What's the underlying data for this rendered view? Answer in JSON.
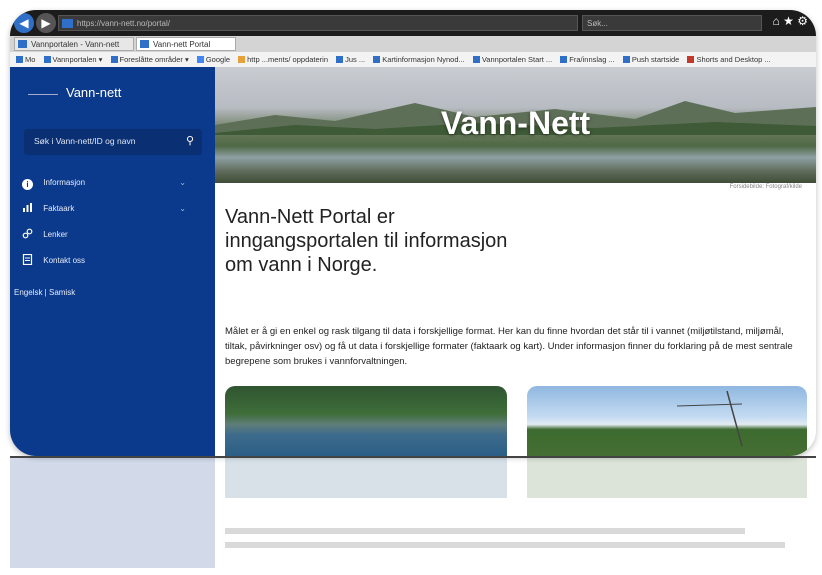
{
  "browser": {
    "url": "https://vann-nett.no/portal/",
    "search_placeholder": "Søk...",
    "tabs": [
      {
        "label": "Vannportalen - Vann-nett"
      },
      {
        "label": "Vann-nett Portal"
      }
    ],
    "favorites": [
      "Mo",
      "Vannportalen ▾",
      "Foreslåtte områder ▾",
      "Google",
      "http ...ments/ oppdaterin",
      "Jus ...",
      "Kartinformasjon Nynod...",
      "Vannportalen Start ...",
      "Fra/innslag ...",
      "Push startside",
      "Shorts and Desktop ..."
    ]
  },
  "sidebar": {
    "brand": "Vann-nett",
    "search_placeholder": "Søk i Vann-nett/ID og navn",
    "items": [
      {
        "label": "Informasjon",
        "icon": "info-icon"
      },
      {
        "label": "Faktaark",
        "icon": "chart-icon"
      },
      {
        "label": "Lenker",
        "icon": "link-icon"
      },
      {
        "label": "Kontakt oss",
        "icon": "contact-icon"
      }
    ],
    "languages": "Engelsk | Samisk"
  },
  "hero": {
    "title": "Vann-Nett",
    "caption": "Forsidebilde: Fotograf/kilde"
  },
  "main": {
    "headline": "Vann-Nett Portal er inngangsportalen til informasjon om vann i Norge.",
    "intro": "Målet er å gi en enkel og rask tilgang til data i forskjellige format. Her kan du finne hvordan det står til i vannet (miljøtilstand, miljømål, tiltak, påvirkninger osv) og få ut data i forskjellige formater (faktaark og kart). Under informasjon finner du forklaring på de mest sentrale begrepene som brukes i vannforvaltningen."
  }
}
